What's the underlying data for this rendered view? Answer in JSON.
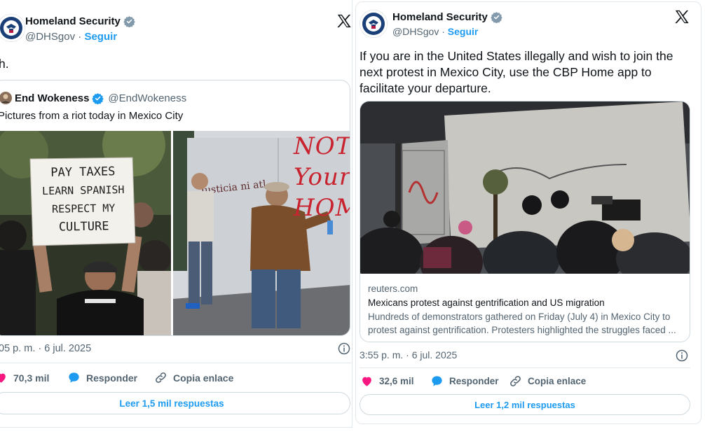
{
  "left_tweet": {
    "author": {
      "name": "Homeland Security",
      "handle": "@DHSgov",
      "separator": "·",
      "follow_label": "Seguir"
    },
    "text": "h.",
    "quote": {
      "author_name": "End Wokeness",
      "author_handle": "@EndWokeness",
      "text": "Pictures from a riot today in Mexico City",
      "sign_lines": [
        "PAY TAXES",
        "LEARN SPANISH",
        "RESPECT MY",
        "CULTURE"
      ],
      "graffiti": [
        "NOT",
        "Your",
        "HOM"
      ]
    },
    "timestamp": "05 p. m. · 6 jul. 2025",
    "actions": {
      "likes": "70,3 mil",
      "reply_label": "Responder",
      "copy_label": "Copia enlace"
    },
    "read_replies": "Leer 1,5 mil respuestas"
  },
  "right_tweet": {
    "author": {
      "name": "Homeland Security",
      "handle": "@DHSgov",
      "separator": "·",
      "follow_label": "Seguir"
    },
    "text": "If you are in the United States illegally and wish to join the next protest in Mexico City, use the CBP Home app to facilitate your departure.",
    "link_card": {
      "domain": "reuters.com",
      "title": "Mexicans protest against gentrification and US migration",
      "description": "Hundreds of demonstrators gathered on Friday (July 4) in Mexico City to protest against gentrification. Protesters highlighted the struggles faced ..."
    },
    "timestamp": "3:55 p. m. · 6 jul. 2025",
    "actions": {
      "likes": "32,6 mil",
      "reply_label": "Responder",
      "copy_label": "Copia enlace"
    },
    "read_replies": "Leer 1,2 mil respuestas"
  },
  "colors": {
    "accent": "#1d9bf0",
    "like": "#f91880",
    "muted": "#536471",
    "text": "#0f1419",
    "border": "#cfd9de"
  },
  "icons": [
    "dhs-seal-icon",
    "verified-badge-icon",
    "x-logo-icon",
    "info-icon",
    "heart-icon",
    "reply-bubble-icon",
    "link-icon"
  ]
}
